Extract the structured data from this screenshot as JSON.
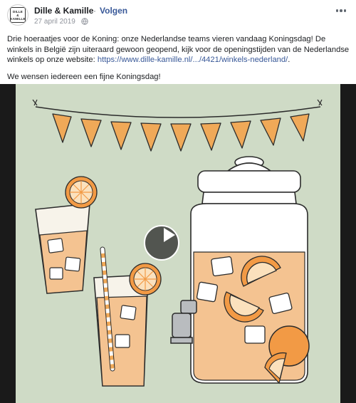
{
  "header": {
    "page_name": "Dille & Kamille",
    "separator": "·",
    "follow_label": "Volgen",
    "date": "27 april 2019",
    "avatar_text": [
      "DILLE",
      "&",
      "KAMILLE"
    ],
    "icons": {
      "privacy": "globe-icon",
      "more": "more-options-icon",
      "play": "play-icon"
    }
  },
  "post": {
    "para1_text": "Drie hoeraatjes voor de Koning: onze Nederlandse teams vieren vandaag Koningsdag! De winkels in België zijn uiteraard gewoon geopend, kijk voor de openingstijden van de Nederlandse winkels op onze website: ",
    "link_text": "https://www.dille-kamille.nl/.../4421/winkels-nederland/",
    "para1_end": ".",
    "para2_text": "We wensen iedereen een fijne Koningsdag!"
  },
  "colors": {
    "link": "#385898",
    "background": "#cfdbc6",
    "bunting": "#f0a958",
    "drink": "#f4c391",
    "orange": "#f29a45",
    "line": "#2b2b2b"
  }
}
